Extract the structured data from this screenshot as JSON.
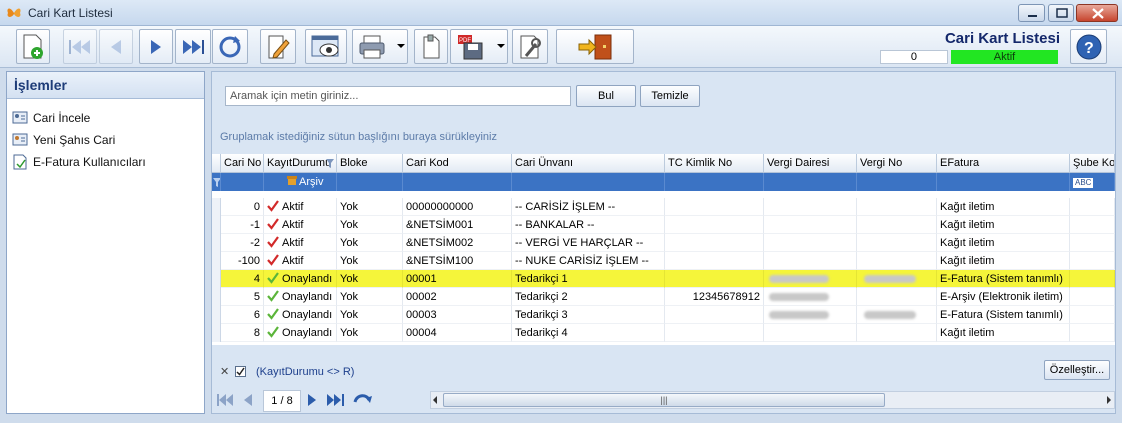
{
  "window": {
    "title": "Cari Kart Listesi"
  },
  "header": {
    "title": "Cari Kart Listesi",
    "counter": "0",
    "status": "Aktif",
    "status_color": "#22e622"
  },
  "toolbar": {
    "buttons": [
      {
        "name": "new-icon"
      },
      {
        "name": "first-icon"
      },
      {
        "name": "prev-icon"
      },
      {
        "name": "next-icon"
      },
      {
        "name": "last-icon"
      },
      {
        "name": "refresh-icon"
      },
      {
        "name": "edit-icon"
      },
      {
        "name": "preview-icon"
      },
      {
        "name": "print-icon"
      },
      {
        "name": "copy-icon"
      },
      {
        "name": "pdf-save-icon"
      },
      {
        "name": "settings-icon"
      },
      {
        "name": "exit-icon"
      }
    ]
  },
  "sidebar": {
    "title": "İşlemler",
    "items": [
      {
        "label": "Cari İncele",
        "icon": "card-icon"
      },
      {
        "label": "Yeni Şahıs Cari",
        "icon": "person-card-icon"
      },
      {
        "label": "E-Fatura Kullanıcıları",
        "icon": "document-icon"
      }
    ]
  },
  "search": {
    "placeholder": "Aramak için metin giriniz...",
    "find_label": "Bul",
    "clear_label": "Temizle"
  },
  "group_hint": "Gruplamak istediğiniz sütun başlığını buraya sürükleyiniz",
  "grid": {
    "columns": [
      "Cari No",
      "KayıtDurumu",
      "Bloke",
      "Cari Kod",
      "Cari Ünvanı",
      "TC Kimlik No",
      "Vergi Dairesi",
      "Vergi No",
      "EFatura",
      "Şube Kod"
    ],
    "filter": {
      "kayit_durumu": "Arşiv"
    },
    "rows": [
      {
        "no": "0",
        "status": "Aktif",
        "status_kind": "red",
        "bloke": "Yok",
        "kod": "00000000000",
        "unvan": "-- CARİSİZ İŞLEM --",
        "tc": "",
        "vd": "",
        "vn": "",
        "efatura": "Kağıt iletim",
        "hl": false
      },
      {
        "no": "-1",
        "status": "Aktif",
        "status_kind": "red",
        "bloke": "Yok",
        "kod": "&NETSİM001",
        "unvan": "-- BANKALAR --",
        "tc": "",
        "vd": "",
        "vn": "",
        "efatura": "Kağıt iletim",
        "hl": false
      },
      {
        "no": "-2",
        "status": "Aktif",
        "status_kind": "red",
        "bloke": "Yok",
        "kod": "&NETSİM002",
        "unvan": "-- VERGİ VE HARÇLAR --",
        "tc": "",
        "vd": "",
        "vn": "",
        "efatura": "Kağıt iletim",
        "hl": false
      },
      {
        "no": "-100",
        "status": "Aktif",
        "status_kind": "red",
        "bloke": "Yok",
        "kod": "&NETSİM100",
        "unvan": "-- NUKE CARİSİZ İŞLEM --",
        "tc": "",
        "vd": "",
        "vn": "",
        "efatura": "Kağıt iletim",
        "hl": false
      },
      {
        "no": "4",
        "status": "Onaylandı",
        "status_kind": "green",
        "bloke": "Yok",
        "kod": "00001",
        "unvan": "Tedarikçi 1",
        "tc": "",
        "vd": "blur",
        "vn": "blur",
        "efatura": "E-Fatura (Sistem tanımlı)",
        "hl": true
      },
      {
        "no": "5",
        "status": "Onaylandı",
        "status_kind": "green",
        "bloke": "Yok",
        "kod": "00002",
        "unvan": "Tedarikçi 2",
        "tc": "12345678912",
        "vd": "blur",
        "vn": "",
        "efatura": "E-Arşiv (Elektronik iletim)",
        "hl": false
      },
      {
        "no": "6",
        "status": "Onaylandı",
        "status_kind": "green",
        "bloke": "Yok",
        "kod": "00003",
        "unvan": "Tedarikçi 3",
        "tc": "",
        "vd": "blur",
        "vn": "blur",
        "efatura": "E-Fatura (Sistem tanımlı)",
        "hl": false
      },
      {
        "no": "8",
        "status": "Onaylandı",
        "status_kind": "green",
        "bloke": "Yok",
        "kod": "00004",
        "unvan": "Tedarikçi 4",
        "tc": "",
        "vd": "",
        "vn": "",
        "efatura": "Kağıt iletim",
        "hl": false
      }
    ]
  },
  "filter_bar": {
    "condition": "(KayıtDurumu <> R)",
    "customize_label": "Özelleştir..."
  },
  "pager": {
    "page": "1 / 8"
  }
}
